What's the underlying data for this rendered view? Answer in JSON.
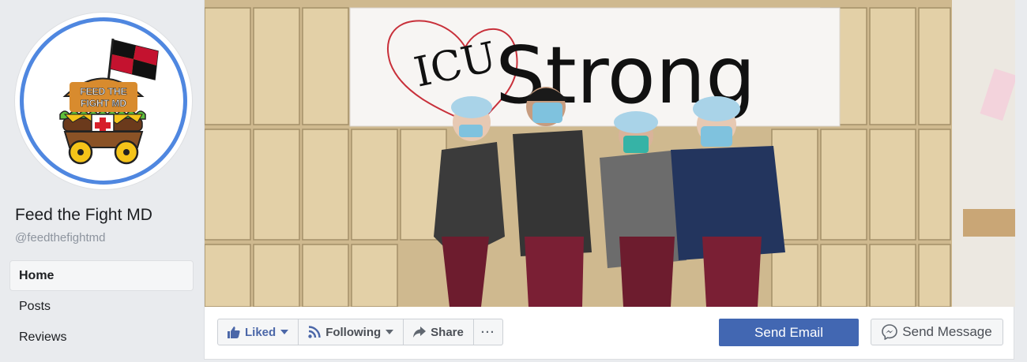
{
  "page": {
    "name": "Feed the Fight MD",
    "handle": "@feedthefightmd",
    "logo_text": "FEED THE FIGHT MD"
  },
  "sidebar": {
    "items": [
      {
        "label": "Home",
        "active": true
      },
      {
        "label": "Posts",
        "active": false
      },
      {
        "label": "Reviews",
        "active": false
      }
    ]
  },
  "cover": {
    "banner_text_left": "ICU",
    "banner_text_right": "Strong"
  },
  "actions": {
    "liked_label": "Liked",
    "following_label": "Following",
    "share_label": "Share",
    "more_label": "···",
    "send_email_label": "Send Email",
    "send_message_label": "Send Message"
  },
  "colors": {
    "primary_button": "#4267b2",
    "liked_text": "#4b67a8",
    "avatar_ring": "#4f87e0",
    "background": "#e9ebee"
  }
}
